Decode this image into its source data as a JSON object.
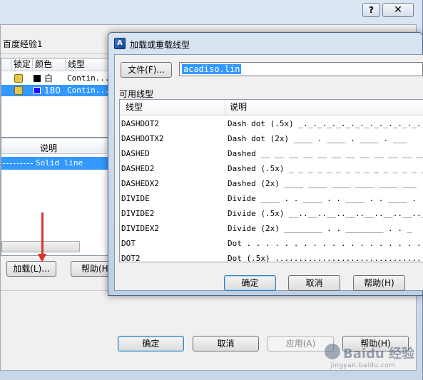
{
  "background": {
    "filter_label": "百度经验1",
    "layer_table": {
      "headers": [
        "锁定",
        "颜色",
        "线型"
      ],
      "rows": [
        {
          "color_name": "白",
          "color_hex": "#000000",
          "linetype": "Contin..."
        },
        {
          "color_name": "180",
          "color_hex": "#2b00ff",
          "linetype": "Contin..."
        }
      ]
    },
    "detail_header": "说明",
    "detail_row": "Solid line",
    "buttons": {
      "load": "加载(L)...",
      "help_small": "帮助(H",
      "ok": "确定",
      "cancel": "取消",
      "apply": "应用(A)",
      "help": "帮助(H)"
    },
    "title_help_glyph": "?",
    "title_close_glyph": "✕"
  },
  "modal": {
    "title": "加载或重载线型",
    "app_icon_glyph": "A",
    "file_button": "文件(F)...",
    "file_value": "acadiso.lin",
    "available_label": "可用线型",
    "columns": {
      "linetype": "线型",
      "description": "说明"
    },
    "rows": [
      {
        "name": "DASHDOT2",
        "desc": "Dash dot (.5x) _._._._._._._._._._._._._."
      },
      {
        "name": "DASHDOTX2",
        "desc": "Dash dot (2x) ____  .  ____  .  ____  .  ___"
      },
      {
        "name": "DASHED",
        "desc": "Dashed __ __ __ __ __ __ __ __ __ __ __ __ __ _"
      },
      {
        "name": "DASHED2",
        "desc": "Dashed (.5x) _ _ _ _ _ _ _ _ _ _ _ _ _ _ _ _ _"
      },
      {
        "name": "DASHEDX2",
        "desc": "Dashed (2x) ____  ____  ____  ____  ____  ___"
      },
      {
        "name": "DIVIDE",
        "desc": "Divide ____ . . ____ . . ____ . . ____ . . ____"
      },
      {
        "name": "DIVIDE2",
        "desc": "Divide (.5x) __..__..__..__..__..__..__..__.._"
      },
      {
        "name": "DIVIDEX2",
        "desc": "Divide (2x) ________  .  .  ________  .  .  _"
      },
      {
        "name": "DOT",
        "desc": "Dot . . . . . . . . . . . . . . . . . . . . . . ."
      },
      {
        "name": "DOT2",
        "desc": "Dot (.5x) ..........................................."
      }
    ],
    "buttons": {
      "ok": "确定",
      "cancel": "取消",
      "help": "帮助(H)"
    }
  },
  "watermark": {
    "brand": "Baidu 经验",
    "sub": "jingyan.baidu.com"
  }
}
